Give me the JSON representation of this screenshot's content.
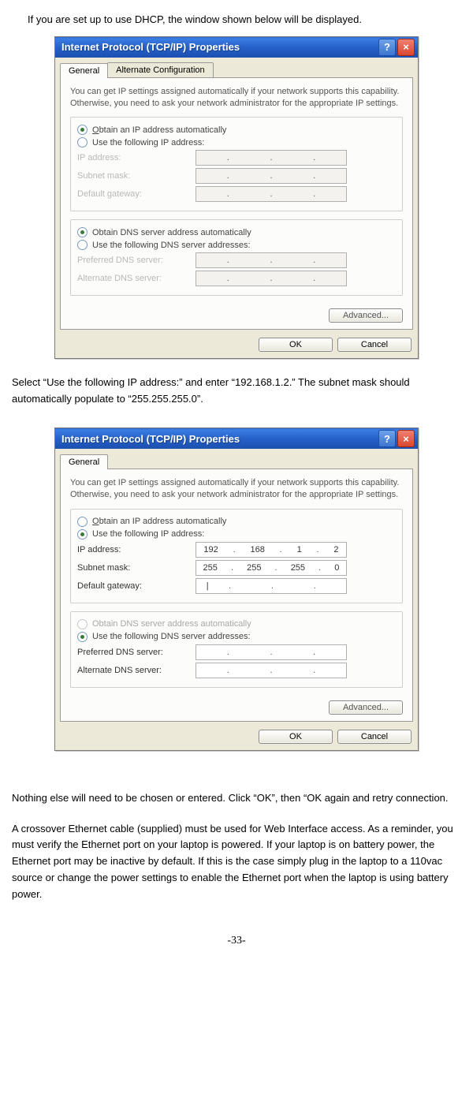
{
  "para1": "If you are set up to use DHCP, the window shown below will be displayed.",
  "para2": "Select “Use the following IP address:” and enter “192.168.1.2.”  The subnet mask should automatically populate to “255.255.255.0”.",
  "para3": "Nothing else will need  to be chosen or entered. Click “OK”, then “OK again and retry connection.",
  "para4": "A crossover Ethernet cable (supplied) must be used for Web Interface access.  As a reminder, you must verify the Ethernet port on your laptop is powered. If your laptop is on battery power, the Ethernet port may be inactive by default.  If this is the case simply plug in the laptop to a 110vac source or change the power settings to enable the Ethernet port when the laptop is using battery power.",
  "pageNum": "-33-",
  "dialog": {
    "title": "Internet Protocol (TCP/IP) Properties",
    "tabGeneral": "General",
    "tabAlt": "Alternate Configuration",
    "desc": "You can get IP settings assigned automatically if your network supports this capability. Otherwise, you need to ask your network administrator for the appropriate IP settings.",
    "optAutoIP": "Obtain an IP address automatically",
    "optUseIP": "Use the following IP address:",
    "lblIP": "IP address:",
    "lblMask": "Subnet mask:",
    "lblGateway": "Default gateway:",
    "optAutoDNS": "Obtain DNS server address automatically",
    "optUseDNS": "Use the following DNS server addresses:",
    "lblPrefDNS": "Preferred DNS server:",
    "lblAltDNS": "Alternate DNS server:",
    "btnAdvanced": "Advanced...",
    "btnOK": "OK",
    "btnCancel": "Cancel"
  },
  "dialog2": {
    "ip": [
      "192",
      "168",
      "1",
      "2"
    ],
    "mask": [
      "255",
      "255",
      "255",
      "0"
    ],
    "gwCursor": "|"
  }
}
